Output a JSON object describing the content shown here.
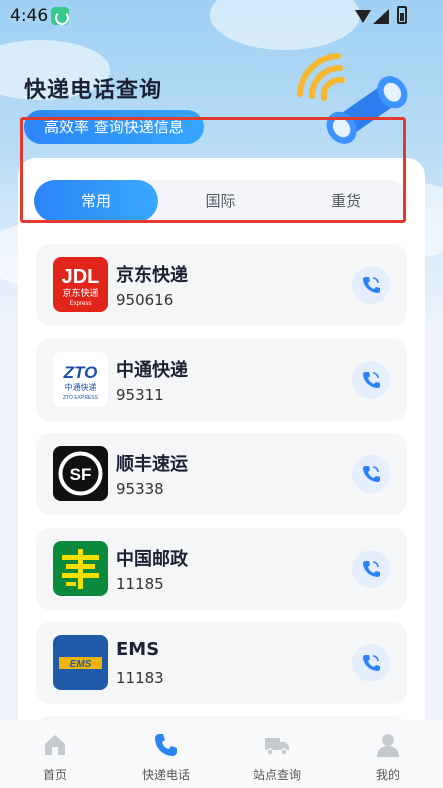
{
  "status_bar": {
    "time": "4:46"
  },
  "header": {
    "title": "快递电话查询",
    "subtitle": "高效率 查询快递信息"
  },
  "tabs": [
    {
      "label": "常用",
      "active": true
    },
    {
      "label": "国际",
      "active": false
    },
    {
      "label": "重货",
      "active": false
    }
  ],
  "carriers": [
    {
      "name": "京东快递",
      "phone": "950616",
      "logo": {
        "text": "JDL",
        "sub": "京东快递",
        "tag": "Express",
        "color": "#e1251b"
      }
    },
    {
      "name": "中通快递",
      "phone": "95311",
      "logo": {
        "text": "ZTO",
        "sub": "中通快递",
        "tag": "ZTO EXPRESS",
        "color": "#1a4ea8"
      }
    },
    {
      "name": "顺丰速运",
      "phone": "95338",
      "logo": {
        "text": "SF",
        "color": "#111111"
      }
    },
    {
      "name": "中国邮政",
      "phone": "11185",
      "logo": {
        "color": "#0b8a3e"
      }
    },
    {
      "name": "EMS",
      "phone": "11183",
      "logo": {
        "text": "EMS",
        "color": "#1f5aa8"
      }
    }
  ],
  "bottom_nav": [
    {
      "label": "首页",
      "icon": "home-icon",
      "active": false
    },
    {
      "label": "快递电话",
      "icon": "phone-icon",
      "active": true
    },
    {
      "label": "站点查询",
      "icon": "truck-icon",
      "active": false
    },
    {
      "label": "我的",
      "icon": "user-icon",
      "active": false
    }
  ],
  "colors": {
    "accent": "#2b84f6",
    "highlight": "#e13b2f",
    "inactive_icon": "#c5c9d0"
  }
}
